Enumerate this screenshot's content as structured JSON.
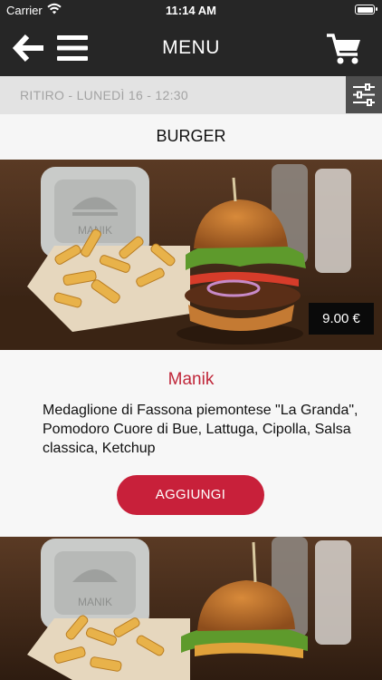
{
  "status_bar": {
    "carrier": "Carrier",
    "time": "11:14 AM"
  },
  "navbar": {
    "title": "MENU"
  },
  "pickup": {
    "text": "RITIRO - LUNEDÌ 16 - 12:30"
  },
  "section": {
    "title": "BURGER"
  },
  "items": [
    {
      "price": "9.00 €",
      "name": "Manik",
      "description": "Medaglione di Fassona piemontese \"La Granda\", Pomodoro Cuore di Bue, Lattuga, Cipolla, Salsa classica, Ketchup",
      "add_label": "AGGIUNGI"
    }
  ],
  "colors": {
    "bar": "#262626",
    "accent": "#c8203a",
    "name": "#c0273a"
  },
  "icons": [
    "wifi-icon",
    "battery-icon",
    "back-arrow-icon",
    "hamburger-menu-icon",
    "cart-icon",
    "filter-sliders-icon"
  ]
}
